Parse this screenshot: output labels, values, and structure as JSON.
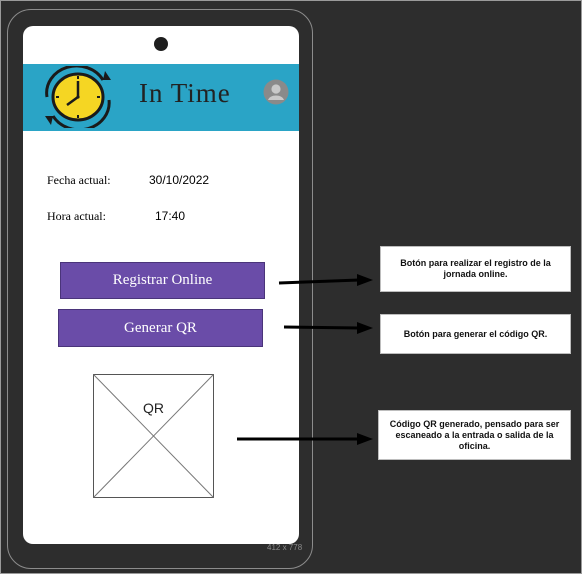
{
  "app": {
    "title": "In Time",
    "logo_icon": "clock-refresh-icon",
    "profile_icon": "user-avatar-icon"
  },
  "fields": {
    "date_label": "Fecha actual:",
    "date_value": "30/10/2022",
    "time_label": "Hora actual:",
    "time_value": "17:40"
  },
  "buttons": {
    "register_label": "Registrar Online",
    "generate_qr_label": "Generar QR"
  },
  "qr_placeholder": {
    "label": "QR"
  },
  "frame_size_label": "412 x 778",
  "annotations": {
    "register_note": "Botón para realizar el registro  de la jornada online.",
    "qr_button_note": "Botón para generar el código QR.",
    "qr_code_note": "Código QR generado, pensado para ser escaneado a la entrada o salida de la oficina."
  },
  "colors": {
    "background": "#2d2d2d",
    "header": "#2aa4c6",
    "button": "#6a4ca8",
    "clock_face": "#f5d623"
  }
}
